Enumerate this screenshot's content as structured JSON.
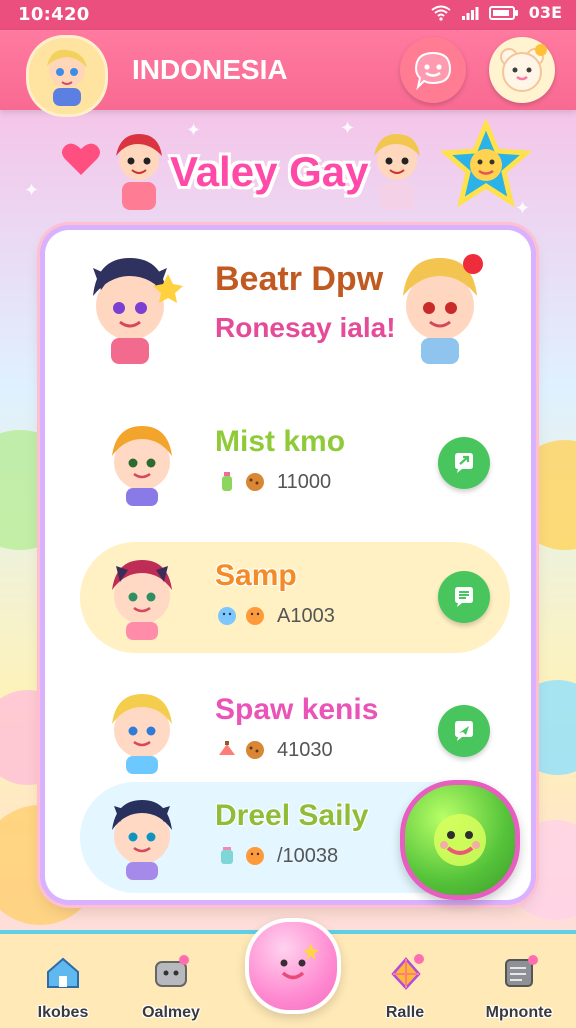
{
  "status": {
    "time": "10:420",
    "battery": "03E"
  },
  "header": {
    "title": "INDONESIA"
  },
  "banner": {
    "title": "Valey Gay"
  },
  "featured": {
    "name": "Beatr Dpw",
    "subtitle": "Ronesay iala!"
  },
  "list": {
    "items": [
      {
        "name": "Mist kmo",
        "value": "11000",
        "name_color": "#8fcb38"
      },
      {
        "name": "Samp",
        "value": "A1003",
        "name_color": "#f28b28"
      },
      {
        "name": "Spaw kenis",
        "value": "41030",
        "name_color": "#ea54b8"
      },
      {
        "name": "Dreel Saily",
        "value": "/10038",
        "name_color": "#8fbd37"
      }
    ]
  },
  "nav": {
    "items": [
      {
        "label": "Ikobes"
      },
      {
        "label": "Oalmey"
      },
      {
        "label": "Ralle"
      },
      {
        "label": "Mpnonte"
      }
    ]
  },
  "colors": {
    "status_bar": "#ea4f7d",
    "header": "#f86a92",
    "panel_border": "#d9b2ff",
    "accent_green": "#49c55e",
    "highlight_row": "#fff1c4"
  },
  "icons": {
    "header_left": "avatar-icon",
    "header_right_1": "chat-face-icon",
    "header_right_2": "bear-icon",
    "list_chat": "chat-arrow-icon",
    "floating": "smile-face-icon",
    "nav": [
      "home-icon",
      "robot-icon",
      "kite-icon",
      "server-icon"
    ]
  }
}
